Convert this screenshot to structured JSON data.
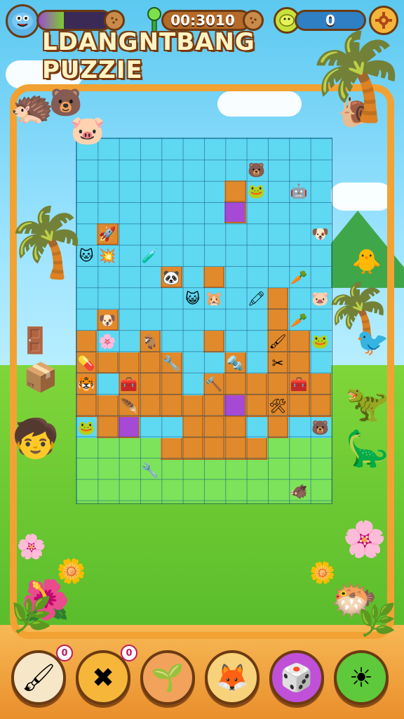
{
  "hud": {
    "progress_fraction": 0.35,
    "timer": "00:3010",
    "score": "0",
    "progress_icon": "smiling-fish-avatar-icon",
    "timer_icon": "green-sprout-icon",
    "score_icon": "lemon-icon",
    "settings_icon": "gear-icon"
  },
  "title": "LDANGNTBANG PUZZIE",
  "tools": [
    {
      "name": "paintbrush-tool",
      "icon": "🖌",
      "badge": "0",
      "color": "#f6e7c8"
    },
    {
      "name": "cross-tool",
      "icon": "✖",
      "badge": "0",
      "color": "#f6b63a"
    },
    {
      "name": "sprout-tool",
      "icon": "🌱",
      "badge": "",
      "color": "#f2a25a"
    },
    {
      "name": "creature-tool",
      "icon": "🦊",
      "badge": "",
      "color": "#f7d27a"
    },
    {
      "name": "dice-tool",
      "icon": "🎲",
      "badge": "",
      "color": "#c050d8"
    },
    {
      "name": "sun-tool",
      "icon": "☀",
      "badge": "",
      "color": "#5ec93a"
    }
  ],
  "colors": {
    "brick": "#e08a2c",
    "brick_dark": "#c46a1c",
    "purple": "#a64ad6",
    "cyan_cell": "#5fd8f2",
    "green_cell": "#7ce35a",
    "frame": "#f2a233"
  },
  "board": {
    "cols": 12,
    "rows": 17,
    "green_start_row": 14,
    "bricks": [
      [
        7,
        2
      ],
      [
        7,
        3
      ],
      [
        1,
        4
      ],
      [
        4,
        6
      ],
      [
        6,
        6
      ],
      [
        9,
        7
      ],
      [
        1,
        8
      ],
      [
        9,
        8
      ],
      [
        0,
        9
      ],
      [
        3,
        9
      ],
      [
        6,
        9
      ],
      [
        9,
        9
      ],
      [
        10,
        9
      ],
      [
        0,
        10
      ],
      [
        1,
        10
      ],
      [
        2,
        10
      ],
      [
        3,
        10
      ],
      [
        4,
        10
      ],
      [
        7,
        10
      ],
      [
        9,
        10
      ],
      [
        10,
        10
      ],
      [
        0,
        11
      ],
      [
        2,
        11
      ],
      [
        3,
        11
      ],
      [
        4,
        11
      ],
      [
        6,
        11
      ],
      [
        7,
        11
      ],
      [
        8,
        11
      ],
      [
        9,
        11
      ],
      [
        10,
        11
      ],
      [
        11,
        11
      ],
      [
        0,
        12
      ],
      [
        1,
        12
      ],
      [
        2,
        12
      ],
      [
        3,
        12
      ],
      [
        4,
        12
      ],
      [
        5,
        12
      ],
      [
        6,
        12
      ],
      [
        8,
        12
      ],
      [
        9,
        12
      ],
      [
        10,
        12
      ],
      [
        11,
        12
      ],
      [
        1,
        13
      ],
      [
        9,
        13
      ],
      [
        6,
        18
      ],
      [
        7,
        18
      ],
      [
        5,
        19
      ],
      [
        6,
        19
      ],
      [
        7,
        19
      ],
      [
        4,
        20
      ],
      [
        5,
        20
      ],
      [
        6,
        20
      ],
      [
        7,
        20
      ],
      [
        8,
        20
      ]
    ],
    "purple": [
      [
        7,
        3
      ],
      [
        7,
        12
      ],
      [
        2,
        13
      ]
    ],
    "pieces": [
      {
        "c": 8,
        "r": 1,
        "icon": "🐻",
        "name": "bear-piece"
      },
      {
        "c": 8,
        "r": 2,
        "icon": "🐸",
        "name": "frog-piece"
      },
      {
        "c": 10,
        "r": 2,
        "icon": "🤖",
        "name": "robot-piece"
      },
      {
        "c": 1,
        "r": 4,
        "icon": "🚀",
        "name": "rocket-piece"
      },
      {
        "c": 11,
        "r": 4,
        "icon": "🐶",
        "name": "dog-piece"
      },
      {
        "c": 0,
        "r": 5,
        "icon": "🐱",
        "name": "cat-piece"
      },
      {
        "c": 1,
        "r": 5,
        "icon": "💥",
        "name": "burst-piece"
      },
      {
        "c": 3,
        "r": 5,
        "icon": "🧪",
        "name": "flask-piece"
      },
      {
        "c": 4,
        "r": 6,
        "icon": "🐼",
        "name": "panda-piece"
      },
      {
        "c": 10,
        "r": 6,
        "icon": "🥕",
        "name": "carrot-piece"
      },
      {
        "c": 5,
        "r": 7,
        "icon": "😺",
        "name": "purple-cat-piece"
      },
      {
        "c": 6,
        "r": 7,
        "icon": "🐹",
        "name": "hamster-piece"
      },
      {
        "c": 8,
        "r": 7,
        "icon": "🖍",
        "name": "crayon-piece"
      },
      {
        "c": 11,
        "r": 7,
        "icon": "🐷",
        "name": "pig-piece"
      },
      {
        "c": 1,
        "r": 8,
        "icon": "🐶",
        "name": "puppy-piece"
      },
      {
        "c": 10,
        "r": 8,
        "icon": "🥕",
        "name": "carrot-piece-2"
      },
      {
        "c": 1,
        "r": 9,
        "icon": "🌸",
        "name": "flower-piece"
      },
      {
        "c": 3,
        "r": 9,
        "icon": "🐐",
        "name": "goat-piece"
      },
      {
        "c": 9,
        "r": 9,
        "icon": "🖌",
        "name": "brush-piece"
      },
      {
        "c": 11,
        "r": 9,
        "icon": "🐸",
        "name": "green-frog-piece"
      },
      {
        "c": 0,
        "r": 10,
        "icon": "💊",
        "name": "capsule-piece"
      },
      {
        "c": 4,
        "r": 10,
        "icon": "🔧",
        "name": "wrench-piece"
      },
      {
        "c": 7,
        "r": 10,
        "icon": "🔩",
        "name": "bolt-piece"
      },
      {
        "c": 9,
        "r": 10,
        "icon": "✂",
        "name": "scissors-piece"
      },
      {
        "c": 0,
        "r": 11,
        "icon": "🐯",
        "name": "tiger-piece"
      },
      {
        "c": 2,
        "r": 11,
        "icon": "🧰",
        "name": "toolbox-piece"
      },
      {
        "c": 6,
        "r": 11,
        "icon": "🔨",
        "name": "hammer-piece"
      },
      {
        "c": 10,
        "r": 11,
        "icon": "🧰",
        "name": "box-piece"
      },
      {
        "c": 2,
        "r": 12,
        "icon": "🪶",
        "name": "feather-piece"
      },
      {
        "c": 9,
        "r": 12,
        "icon": "🛠",
        "name": "tools-piece"
      },
      {
        "c": 0,
        "r": 13,
        "icon": "🐸",
        "name": "small-frog-piece"
      },
      {
        "c": 11,
        "r": 13,
        "icon": "🐻",
        "name": "bear-cub-piece"
      },
      {
        "c": 10,
        "r": 16,
        "icon": "🐗",
        "name": "boar-piece"
      },
      {
        "c": 3,
        "r": 21,
        "icon": "🔧",
        "name": "spanner-piece"
      }
    ]
  }
}
